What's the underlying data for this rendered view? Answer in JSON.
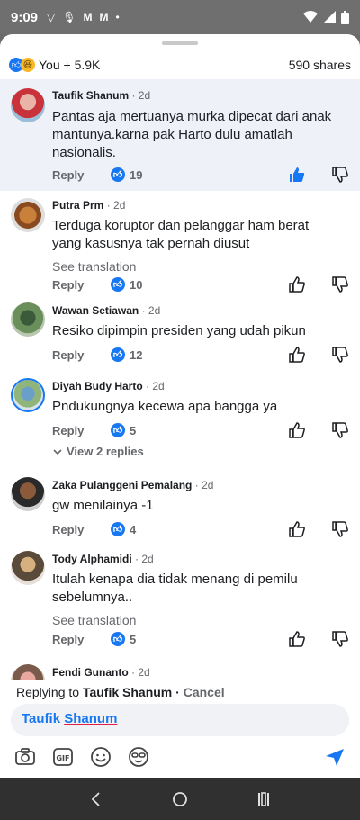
{
  "status": {
    "time": "9:09"
  },
  "reactions": {
    "summary": "You + 5.9K",
    "shares": "590 shares"
  },
  "comments": [
    {
      "name": "Taufik Shanum",
      "time": "· 2d",
      "text": "Pantas aja mertuanya murka dipecat dari anak mantunya.karna pak Harto dulu amatlah nasionalis.",
      "reply": "Reply",
      "likes": "19"
    },
    {
      "name": "Putra Prm",
      "time": "· 2d",
      "text": "Terduga koruptor dan pelanggar ham berat yang kasusnya tak pernah diusut",
      "see_translation": "See translation",
      "reply": "Reply",
      "likes": "10"
    },
    {
      "name": "Wawan Setiawan",
      "time": "· 2d",
      "text": "Resiko dipimpin presiden yang udah pikun",
      "reply": "Reply",
      "likes": "12"
    },
    {
      "name": "Diyah Budy Harto",
      "time": "· 2d",
      "text": "Pndukungnya kecewa apa bangga ya",
      "reply": "Reply",
      "likes": "5",
      "view_replies": "View 2 replies"
    },
    {
      "name": "Zaka Pulanggeni Pemalang",
      "time": "· 2d",
      "text": "gw menilainya -1",
      "reply": "Reply",
      "likes": "4"
    },
    {
      "name": "Tody Alphamidi",
      "time": "· 2d",
      "text": "Itulah kenapa dia tidak menang di pemilu sebelumnya..",
      "see_translation": "See translation",
      "reply": "Reply",
      "likes": "5"
    },
    {
      "name": "Fendi Gunanto",
      "time": "· 2d"
    }
  ],
  "replying": {
    "prefix": "Replying to",
    "name": "Taufik Shanum",
    "sep": " · ",
    "cancel": "Cancel"
  },
  "composer": {
    "first": "Taufik",
    "last": "Shanum"
  }
}
